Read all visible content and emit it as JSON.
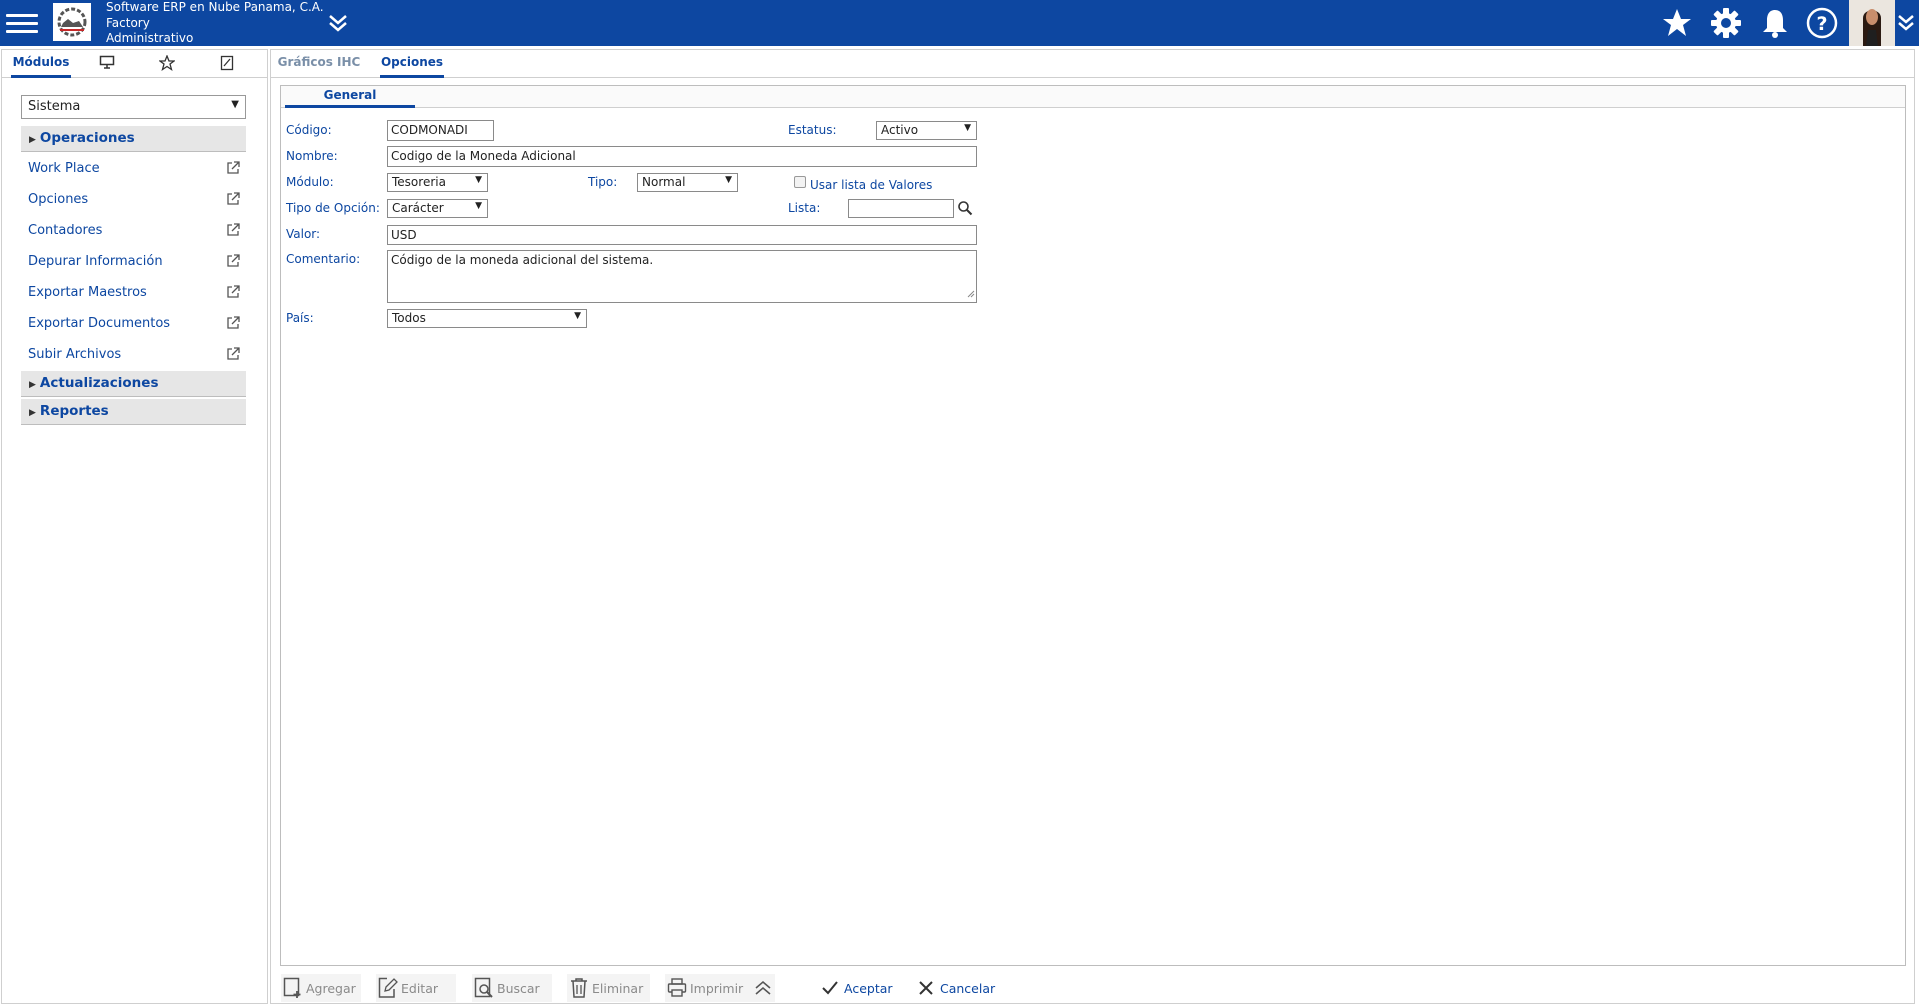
{
  "header": {
    "company_name": "Software ERP en Nube Panama, C.A.",
    "app_name": "Factory",
    "role": "Administrativo",
    "bg_color": "#0d47a1"
  },
  "left_tabs": {
    "modulos_label": "Módulos"
  },
  "module_select": {
    "value": "Sistema"
  },
  "sections": {
    "operaciones": "Operaciones",
    "actualizaciones": "Actualizaciones",
    "reportes": "Reportes"
  },
  "menu_items": [
    "Work Place",
    "Opciones",
    "Contadores",
    "Depurar Información",
    "Exportar Maestros",
    "Exportar Documentos",
    "Subir Archivos"
  ],
  "main_tabs": [
    "Gráficos IHC",
    "Opciones"
  ],
  "form_tab": "General",
  "form": {
    "codigo_label": "Código:",
    "codigo_value": "CODMONADI",
    "estatus_label": "Estatus:",
    "estatus_value": "Activo",
    "nombre_label": "Nombre:",
    "nombre_value": "Codigo de la Moneda Adicional",
    "modulo_label": "Módulo:",
    "modulo_value": "Tesoreria",
    "tipo_label": "Tipo:",
    "tipo_value": "Normal",
    "usar_lista_label": "Usar lista de Valores",
    "tipo_opcion_label": "Tipo de Opción:",
    "tipo_opcion_value": "Carácter",
    "lista_label": "Lista:",
    "lista_value": "",
    "valor_label": "Valor:",
    "valor_value": "USD",
    "comentario_label": "Comentario:",
    "comentario_value": "Código de la moneda adicional del sistema.",
    "pais_label": "País:",
    "pais_value": "Todos"
  },
  "toolbar": {
    "agregar": "Agregar",
    "editar": "Editar",
    "buscar": "Buscar",
    "eliminar": "Eliminar",
    "imprimir": "Imprimir",
    "aceptar": "Aceptar",
    "cancelar": "Cancelar"
  }
}
